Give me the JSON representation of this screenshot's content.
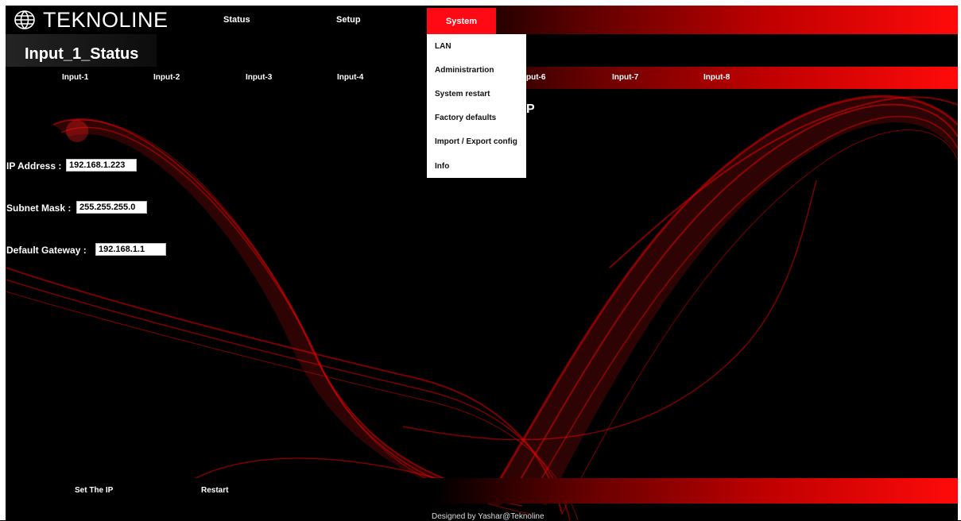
{
  "brand": {
    "name": "TEKNOLINE"
  },
  "nav": {
    "status": "Status",
    "setup": "Setup",
    "system": "System"
  },
  "page": {
    "title": "Input_1_Status",
    "fragment": "P"
  },
  "inputs_tabs": [
    "Input-1",
    "Input-2",
    "Input-3",
    "Input-4",
    "put-6",
    "Input-7",
    "Input-8"
  ],
  "system_menu": [
    "LAN",
    "Administrartion",
    "System restart",
    "Factory defaults",
    "Import / Export config",
    "Info"
  ],
  "form": {
    "ip": {
      "label": "IP Address :",
      "value": "192.168.1.223"
    },
    "mask": {
      "label": "Subnet Mask :",
      "value": "255.255.255.0"
    },
    "gateway": {
      "label": "Default Gateway :",
      "value": "192.168.1.1"
    }
  },
  "footer": {
    "set_ip": "Set The IP",
    "restart": "Restart",
    "credit": "Designed by Yashar@Teknoline"
  },
  "colors": {
    "accent": "#ff0a14",
    "bar_end": "#ff0a0a",
    "background": "#000000"
  }
}
